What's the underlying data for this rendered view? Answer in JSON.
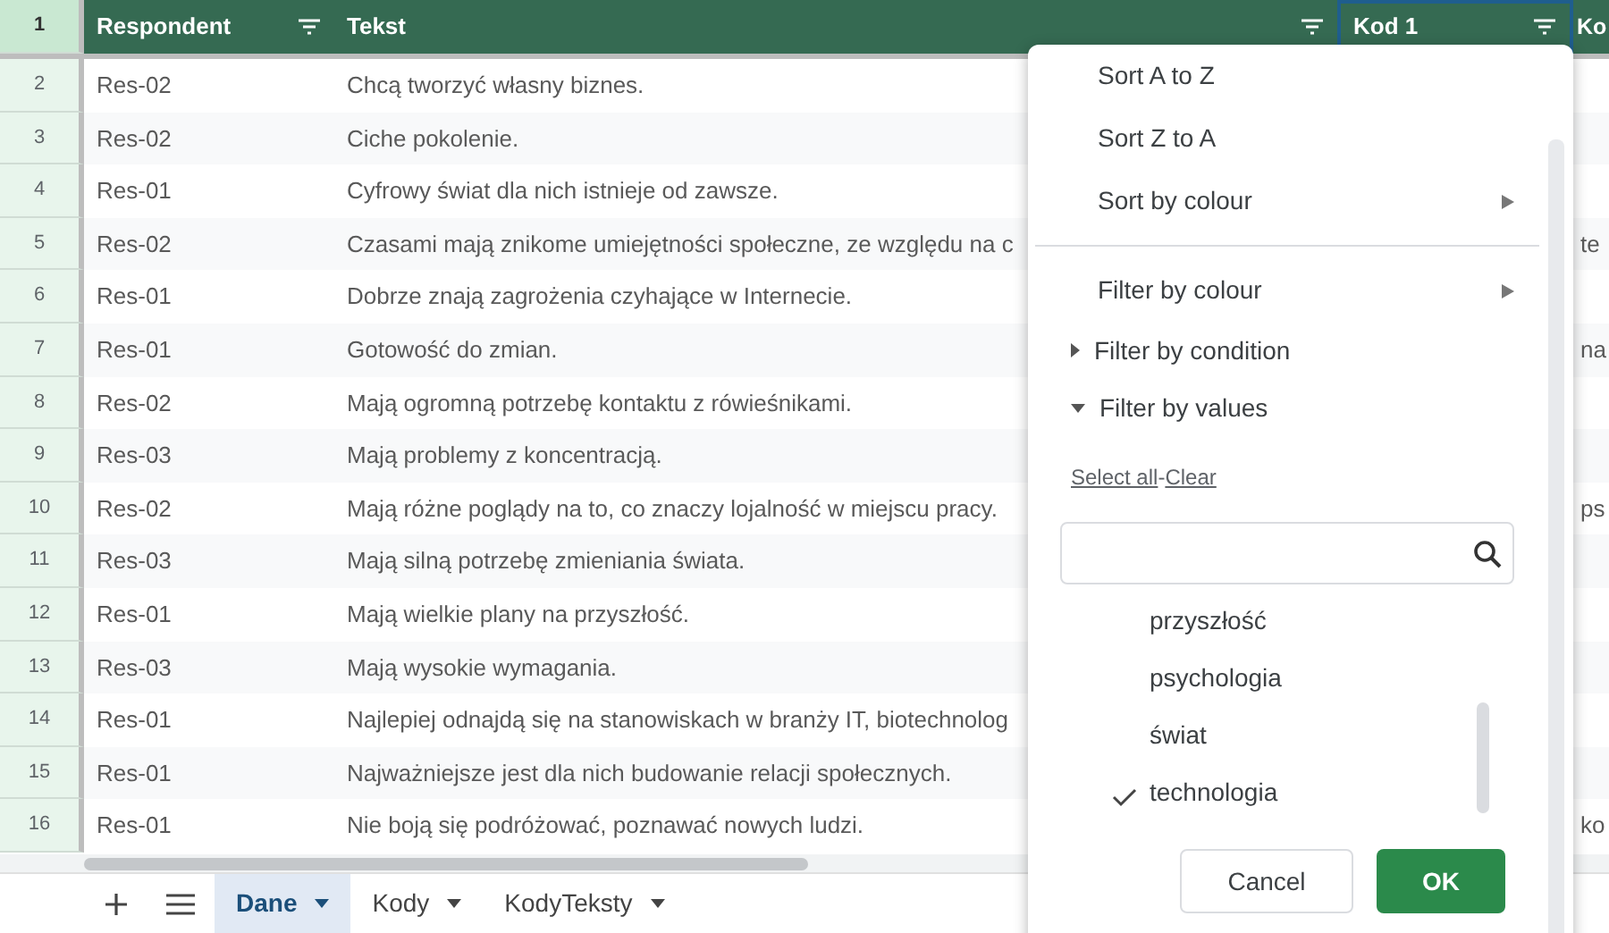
{
  "sheet": {
    "header_row_number": "1",
    "columns": [
      {
        "label": "Respondent",
        "filter": true,
        "selected": false
      },
      {
        "label": "Tekst",
        "filter": true,
        "selected": false
      },
      {
        "label": "Kod 1",
        "filter": true,
        "selected": true
      },
      {
        "label": "Ko",
        "selected": false
      }
    ],
    "rows": [
      {
        "number": "2",
        "respondent": "Res-02",
        "text": "Chcą tworzyć własny biznes."
      },
      {
        "number": "3",
        "respondent": "Res-02",
        "text": "Ciche pokolenie."
      },
      {
        "number": "4",
        "respondent": "Res-01",
        "text": "Cyfrowy świat dla nich istnieje od zawsze."
      },
      {
        "number": "5",
        "respondent": "Res-02",
        "text": "Czasami mają znikome umiejętności społeczne, ze względu na c",
        "column_4": "te"
      },
      {
        "number": "6",
        "respondent": "Res-01",
        "text": "Dobrze znają zagrożenia czyhające w Internecie."
      },
      {
        "number": "7",
        "respondent": "Res-01",
        "text": "Gotowość do zmian.",
        "column_4": "na"
      },
      {
        "number": "8",
        "respondent": "Res-02",
        "text": "Mają ogromną potrzebę kontaktu z rówieśnikami."
      },
      {
        "number": "9",
        "respondent": "Res-03",
        "text": "Mają problemy z koncentracją."
      },
      {
        "number": "10",
        "respondent": "Res-02",
        "text": "Mają różne poglądy na to, co znaczy lojalność w miejscu pracy.",
        "column_4": "ps"
      },
      {
        "number": "11",
        "respondent": "Res-03",
        "text": "Mają silną potrzebę zmieniania świata."
      },
      {
        "number": "12",
        "respondent": "Res-01",
        "text": "Mają wielkie plany na przyszłość."
      },
      {
        "number": "13",
        "respondent": "Res-03",
        "text": "Mają wysokie wymagania."
      },
      {
        "number": "14",
        "respondent": "Res-01",
        "text": "Najlepiej odnajdą się na stanowiskach w branży IT, biotechnolog"
      },
      {
        "number": "15",
        "respondent": "Res-01",
        "text": "Najważniejsze jest dla nich budowanie relacji społecznych."
      },
      {
        "number": "16",
        "respondent": "Res-01",
        "text": "Nie boją się podróżować, poznawać nowych ludzi.",
        "column_4": "ko"
      }
    ]
  },
  "filter_menu": {
    "items": [
      {
        "kind": "item",
        "label": "Sort A to Z",
        "submenu": false
      },
      {
        "kind": "item",
        "label": "Sort Z to A",
        "submenu": false
      },
      {
        "kind": "item",
        "label": "Sort by colour",
        "submenu": true
      },
      {
        "kind": "divider"
      },
      {
        "kind": "item",
        "label": "Filter by colour",
        "submenu": true
      },
      {
        "kind": "section",
        "label": "Filter by condition",
        "expanded": false
      },
      {
        "kind": "section",
        "label": "Filter by values",
        "expanded": true
      }
    ],
    "select_all": "Select all",
    "separator": "-",
    "clear": "Clear",
    "values": [
      {
        "label": "przyszłość",
        "checked": false
      },
      {
        "label": "psychologia",
        "checked": false
      },
      {
        "label": "świat",
        "checked": false
      },
      {
        "label": "technologia",
        "checked": true
      }
    ],
    "cancel": "Cancel",
    "ok": "OK"
  },
  "sheet_tabs": [
    {
      "label": "Dane",
      "selected": true
    },
    {
      "label": "Kody",
      "selected": false
    },
    {
      "label": "KodyTeksty",
      "selected": false
    }
  ]
}
